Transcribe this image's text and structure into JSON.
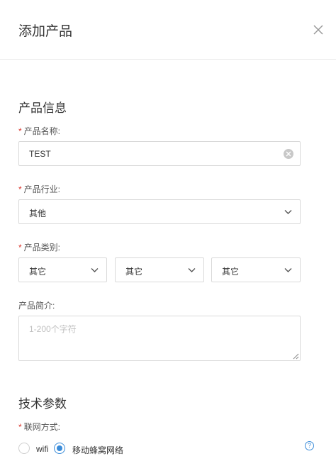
{
  "header": {
    "title": "添加产品",
    "close_icon": "close-icon"
  },
  "product_info": {
    "section_title": "产品信息",
    "required_mark": "*",
    "name": {
      "label": "产品名称:",
      "value": "TEST"
    },
    "industry": {
      "label": "产品行业:",
      "value": "其他"
    },
    "category": {
      "label": "产品类别:",
      "values": [
        "其它",
        "其它",
        "其它"
      ]
    },
    "description": {
      "label": "产品简介:",
      "placeholder": "1-200个字符"
    }
  },
  "tech_params": {
    "section_title": "技术参数",
    "required_mark": "*",
    "network": {
      "label": "联网方式:",
      "options": [
        {
          "label": "wifi",
          "selected": false
        },
        {
          "label": "移动蜂窝网络",
          "selected": true
        }
      ],
      "help_glyph": "?"
    }
  },
  "colors": {
    "accent": "#3b8cd9",
    "required": "#d9342b",
    "border": "#d9d9d9"
  }
}
